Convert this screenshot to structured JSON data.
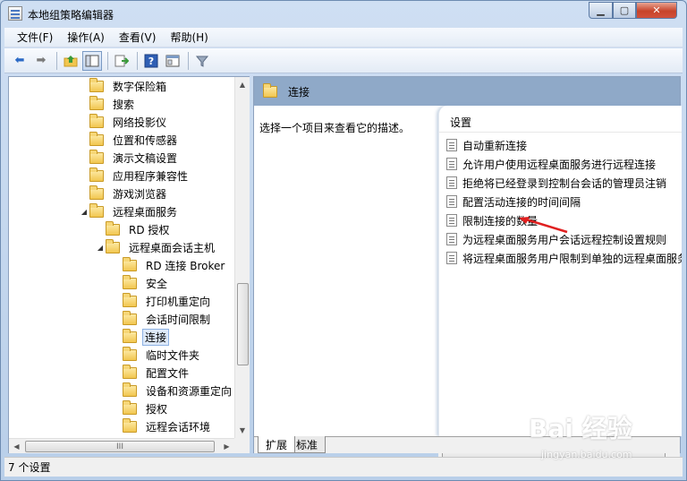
{
  "window": {
    "title": "本地组策略编辑器"
  },
  "menu": [
    "文件(F)",
    "操作(A)",
    "查看(V)",
    "帮助(H)"
  ],
  "toolbar": {
    "icons": [
      "back-arrow-icon",
      "forward-arrow-icon",
      "up-folder-icon",
      "show-hide-tree-icon",
      "export-list-icon",
      "help-icon",
      "properties-icon",
      "filter-icon"
    ]
  },
  "tree": {
    "items": [
      {
        "label": "数字保险箱",
        "level": 2,
        "expander": ""
      },
      {
        "label": "搜索",
        "level": 2,
        "expander": ""
      },
      {
        "label": "网络投影仪",
        "level": 2,
        "expander": ""
      },
      {
        "label": "位置和传感器",
        "level": 2,
        "expander": ""
      },
      {
        "label": "演示文稿设置",
        "level": 2,
        "expander": ""
      },
      {
        "label": "应用程序兼容性",
        "level": 2,
        "expander": ""
      },
      {
        "label": "游戏浏览器",
        "level": 2,
        "expander": ""
      },
      {
        "label": "远程桌面服务",
        "level": 2,
        "expander": "◢"
      },
      {
        "label": "RD 授权",
        "level": 3,
        "expander": ""
      },
      {
        "label": "远程桌面会话主机",
        "level": 3,
        "expander": "◢"
      },
      {
        "label": "RD 连接 Broker",
        "level": 4,
        "expander": ""
      },
      {
        "label": "安全",
        "level": 4,
        "expander": ""
      },
      {
        "label": "打印机重定向",
        "level": 4,
        "expander": ""
      },
      {
        "label": "会话时间限制",
        "level": 4,
        "expander": ""
      },
      {
        "label": "连接",
        "level": 4,
        "expander": "",
        "selected": true
      },
      {
        "label": "临时文件夹",
        "level": 4,
        "expander": ""
      },
      {
        "label": "配置文件",
        "level": 4,
        "expander": ""
      },
      {
        "label": "设备和资源重定向",
        "level": 4,
        "expander": ""
      },
      {
        "label": "授权",
        "level": 4,
        "expander": ""
      },
      {
        "label": "远程会话环境",
        "level": 4,
        "expander": ""
      }
    ],
    "hscroll_label": "III"
  },
  "right": {
    "header_title": "连接",
    "description": "选择一个项目来查看它的描述。",
    "column_header": "设置",
    "settings": [
      "自动重新连接",
      "允许用户使用远程桌面服务进行远程连接",
      "拒绝将已经登录到控制台会话的管理员注销",
      "配置活动连接的时间间隔",
      "限制连接的数量",
      "为远程桌面服务用户会话远程控制设置规则",
      "将远程桌面服务用户限制到单独的远程桌面服务"
    ],
    "tabs": [
      "扩展",
      "标准"
    ]
  },
  "status": {
    "text": "7 个设置"
  },
  "watermark": {
    "main": "Bai 经验",
    "sub": "jingyan.baidu.com"
  },
  "colors": {
    "header_band": "#8fa9c8",
    "selection": "#dde9f9",
    "annotation_arrow": "#e02020"
  }
}
